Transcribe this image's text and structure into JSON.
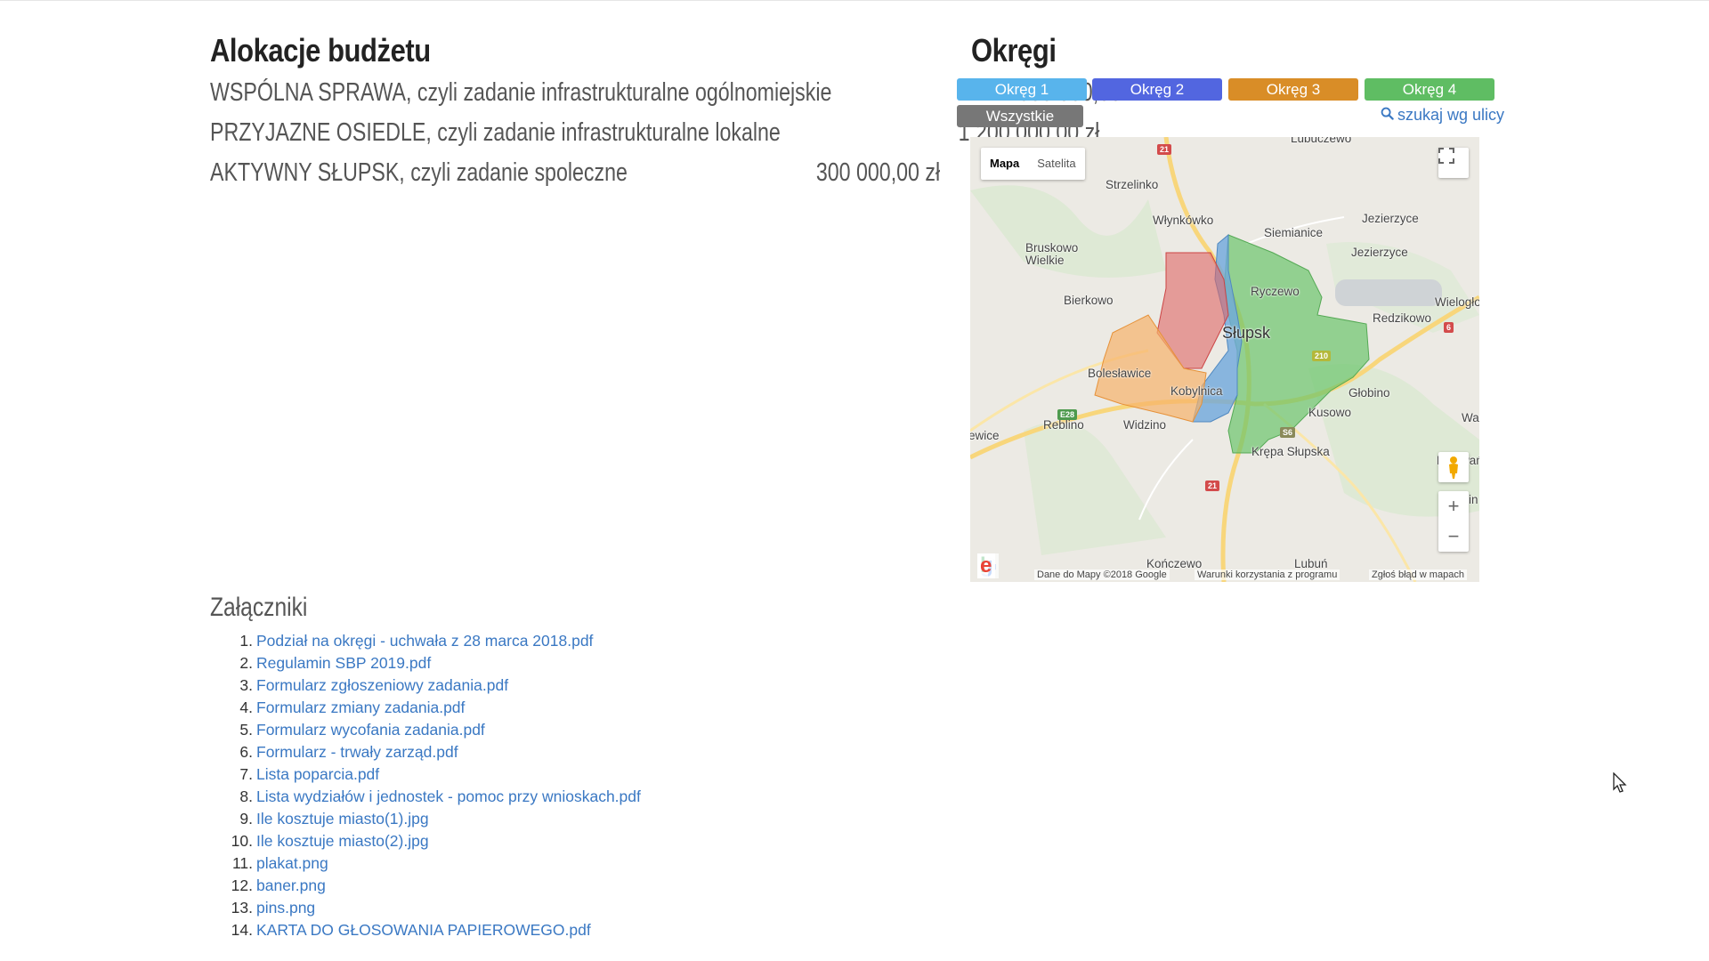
{
  "budget": {
    "title": "Alokacje budżetu",
    "rows": [
      {
        "name": "WSPÓLNA SPRAWA, czyli zadanie infrastrukturalne ogólnomiejskie",
        "amount": "500 000,00 zł"
      },
      {
        "name": "PRZYJAZNE OSIEDLE, czyli zadanie infrastrukturalne lokalne",
        "amount": "1 200 000,00 zł"
      },
      {
        "name": "AKTYWNY SŁUPSK, czyli zadanie spoleczne",
        "amount": "300 000,00 zł"
      }
    ]
  },
  "districts": {
    "title": "Okręgi",
    "buttons": [
      {
        "label": "Okręg 1",
        "color": "#58b4ec"
      },
      {
        "label": "Okręg 2",
        "color": "#5266e0"
      },
      {
        "label": "Okręg 3",
        "color": "#d98d27"
      },
      {
        "label": "Okręg 4",
        "color": "#5fbd63"
      },
      {
        "label": "Wszystkie",
        "color": "#777777"
      }
    ],
    "search_label": "szukaj wg ulicy"
  },
  "map": {
    "type_map": "Mapa",
    "type_satellite": "Satelita",
    "footer_data": "Dane do Mapy ©2018 Google",
    "footer_terms": "Warunki korzystania z programu",
    "footer_report": "Zgłoś błąd w mapach",
    "places": {
      "lubuczewo": "Lubuczewo",
      "strzelinko": "Strzelinko",
      "wlynkowko": "Włynkówko",
      "siemianice": "Siemianice",
      "jezierzyce1": "Jezierzyce",
      "jezierzyce2": "Jezierzyce",
      "bruskowo": "Bruskowo\nWielkie",
      "ryczewo": "Ryczewo",
      "bierkowo": "Bierkowo",
      "wieloglowy": "Wielogłowy",
      "redzikowo": "Redzikowo",
      "slupsk": "Słupsk",
      "boleslawice": "Bolesławice",
      "kobylnica": "Kobylnica",
      "globino": "Głobino",
      "kusowo": "Kusowo",
      "reblino": "Reblino",
      "widzino": "Widzino",
      "wa": "Wa",
      "sewice": "ewice",
      "krepa": "Krępa Słupska",
      "krzywan": "Krzywań",
      "grabin": "Grabin",
      "konczewo": "Kończewo",
      "lubun": "Lubuń"
    },
    "roads": [
      "21",
      "6",
      "210",
      "E28",
      "S6",
      "21"
    ],
    "district_colors": {
      "d1": "#6fa8dc",
      "d2": "#e06666",
      "d3": "#f6b26b",
      "d4": "#6cc46c"
    }
  },
  "attachments": {
    "title": "Załączniki",
    "items": [
      {
        "num": "1.",
        "label": "Podział na okręgi - uchwała z 28 marca 2018.pdf"
      },
      {
        "num": "2.",
        "label": "Regulamin SBP 2019.pdf"
      },
      {
        "num": "3.",
        "label": "Formularz zgłoszeniowy zadania.pdf"
      },
      {
        "num": "4.",
        "label": "Formularz zmiany zadania.pdf"
      },
      {
        "num": "5.",
        "label": "Formularz wycofania zadania.pdf"
      },
      {
        "num": "6.",
        "label": "Formularz - trwały zarząd.pdf"
      },
      {
        "num": "7.",
        "label": "Lista poparcia.pdf"
      },
      {
        "num": "8.",
        "label": "Lista wydziałów i jednostek - pomoc przy wnioskach.pdf"
      },
      {
        "num": "9.",
        "label": "Ile kosztuje miasto(1).jpg"
      },
      {
        "num": "10.",
        "label": "Ile kosztuje miasto(2).jpg"
      },
      {
        "num": "11.",
        "label": "plakat.png"
      },
      {
        "num": "12.",
        "label": "baner.png"
      },
      {
        "num": "13.",
        "label": "pins.png"
      },
      {
        "num": "14.",
        "label": "KARTA DO GŁOSOWANIA PAPIEROWEGO.pdf"
      }
    ]
  }
}
